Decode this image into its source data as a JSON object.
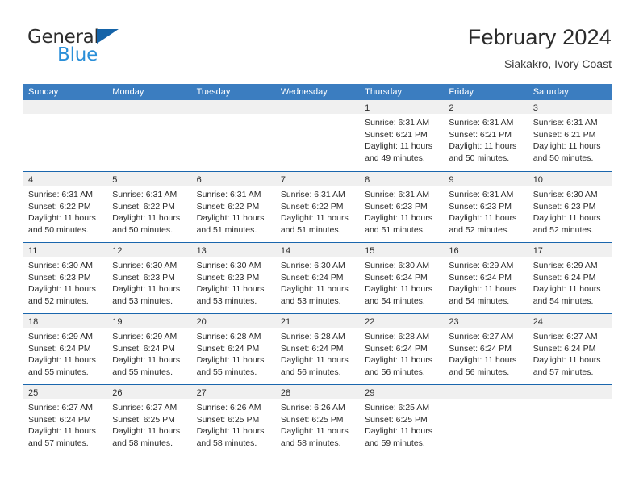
{
  "brand": {
    "name_part1": "General",
    "name_part2": "Blue",
    "accent_color": "#2a8fd8",
    "triangle_color": "#1463a8"
  },
  "header": {
    "title": "February 2024",
    "subtitle": "Siakakro, Ivory Coast"
  },
  "calendar": {
    "header_bg": "#3b7dc0",
    "row_border_color": "#1a66ad",
    "daynum_band_bg": "#f0f0f0",
    "weekdays": [
      "Sunday",
      "Monday",
      "Tuesday",
      "Wednesday",
      "Thursday",
      "Friday",
      "Saturday"
    ],
    "weeks": [
      [
        {
          "day": "",
          "sunrise": "",
          "sunset": "",
          "daylight": "",
          "empty": true
        },
        {
          "day": "",
          "sunrise": "",
          "sunset": "",
          "daylight": "",
          "empty": true
        },
        {
          "day": "",
          "sunrise": "",
          "sunset": "",
          "daylight": "",
          "empty": true
        },
        {
          "day": "",
          "sunrise": "",
          "sunset": "",
          "daylight": "",
          "empty": true
        },
        {
          "day": "1",
          "sunrise": "Sunrise: 6:31 AM",
          "sunset": "Sunset: 6:21 PM",
          "daylight": "Daylight: 11 hours and 49 minutes."
        },
        {
          "day": "2",
          "sunrise": "Sunrise: 6:31 AM",
          "sunset": "Sunset: 6:21 PM",
          "daylight": "Daylight: 11 hours and 50 minutes."
        },
        {
          "day": "3",
          "sunrise": "Sunrise: 6:31 AM",
          "sunset": "Sunset: 6:21 PM",
          "daylight": "Daylight: 11 hours and 50 minutes."
        }
      ],
      [
        {
          "day": "4",
          "sunrise": "Sunrise: 6:31 AM",
          "sunset": "Sunset: 6:22 PM",
          "daylight": "Daylight: 11 hours and 50 minutes."
        },
        {
          "day": "5",
          "sunrise": "Sunrise: 6:31 AM",
          "sunset": "Sunset: 6:22 PM",
          "daylight": "Daylight: 11 hours and 50 minutes."
        },
        {
          "day": "6",
          "sunrise": "Sunrise: 6:31 AM",
          "sunset": "Sunset: 6:22 PM",
          "daylight": "Daylight: 11 hours and 51 minutes."
        },
        {
          "day": "7",
          "sunrise": "Sunrise: 6:31 AM",
          "sunset": "Sunset: 6:22 PM",
          "daylight": "Daylight: 11 hours and 51 minutes."
        },
        {
          "day": "8",
          "sunrise": "Sunrise: 6:31 AM",
          "sunset": "Sunset: 6:23 PM",
          "daylight": "Daylight: 11 hours and 51 minutes."
        },
        {
          "day": "9",
          "sunrise": "Sunrise: 6:31 AM",
          "sunset": "Sunset: 6:23 PM",
          "daylight": "Daylight: 11 hours and 52 minutes."
        },
        {
          "day": "10",
          "sunrise": "Sunrise: 6:30 AM",
          "sunset": "Sunset: 6:23 PM",
          "daylight": "Daylight: 11 hours and 52 minutes."
        }
      ],
      [
        {
          "day": "11",
          "sunrise": "Sunrise: 6:30 AM",
          "sunset": "Sunset: 6:23 PM",
          "daylight": "Daylight: 11 hours and 52 minutes."
        },
        {
          "day": "12",
          "sunrise": "Sunrise: 6:30 AM",
          "sunset": "Sunset: 6:23 PM",
          "daylight": "Daylight: 11 hours and 53 minutes."
        },
        {
          "day": "13",
          "sunrise": "Sunrise: 6:30 AM",
          "sunset": "Sunset: 6:23 PM",
          "daylight": "Daylight: 11 hours and 53 minutes."
        },
        {
          "day": "14",
          "sunrise": "Sunrise: 6:30 AM",
          "sunset": "Sunset: 6:24 PM",
          "daylight": "Daylight: 11 hours and 53 minutes."
        },
        {
          "day": "15",
          "sunrise": "Sunrise: 6:30 AM",
          "sunset": "Sunset: 6:24 PM",
          "daylight": "Daylight: 11 hours and 54 minutes."
        },
        {
          "day": "16",
          "sunrise": "Sunrise: 6:29 AM",
          "sunset": "Sunset: 6:24 PM",
          "daylight": "Daylight: 11 hours and 54 minutes."
        },
        {
          "day": "17",
          "sunrise": "Sunrise: 6:29 AM",
          "sunset": "Sunset: 6:24 PM",
          "daylight": "Daylight: 11 hours and 54 minutes."
        }
      ],
      [
        {
          "day": "18",
          "sunrise": "Sunrise: 6:29 AM",
          "sunset": "Sunset: 6:24 PM",
          "daylight": "Daylight: 11 hours and 55 minutes."
        },
        {
          "day": "19",
          "sunrise": "Sunrise: 6:29 AM",
          "sunset": "Sunset: 6:24 PM",
          "daylight": "Daylight: 11 hours and 55 minutes."
        },
        {
          "day": "20",
          "sunrise": "Sunrise: 6:28 AM",
          "sunset": "Sunset: 6:24 PM",
          "daylight": "Daylight: 11 hours and 55 minutes."
        },
        {
          "day": "21",
          "sunrise": "Sunrise: 6:28 AM",
          "sunset": "Sunset: 6:24 PM",
          "daylight": "Daylight: 11 hours and 56 minutes."
        },
        {
          "day": "22",
          "sunrise": "Sunrise: 6:28 AM",
          "sunset": "Sunset: 6:24 PM",
          "daylight": "Daylight: 11 hours and 56 minutes."
        },
        {
          "day": "23",
          "sunrise": "Sunrise: 6:27 AM",
          "sunset": "Sunset: 6:24 PM",
          "daylight": "Daylight: 11 hours and 56 minutes."
        },
        {
          "day": "24",
          "sunrise": "Sunrise: 6:27 AM",
          "sunset": "Sunset: 6:24 PM",
          "daylight": "Daylight: 11 hours and 57 minutes."
        }
      ],
      [
        {
          "day": "25",
          "sunrise": "Sunrise: 6:27 AM",
          "sunset": "Sunset: 6:24 PM",
          "daylight": "Daylight: 11 hours and 57 minutes."
        },
        {
          "day": "26",
          "sunrise": "Sunrise: 6:27 AM",
          "sunset": "Sunset: 6:25 PM",
          "daylight": "Daylight: 11 hours and 58 minutes."
        },
        {
          "day": "27",
          "sunrise": "Sunrise: 6:26 AM",
          "sunset": "Sunset: 6:25 PM",
          "daylight": "Daylight: 11 hours and 58 minutes."
        },
        {
          "day": "28",
          "sunrise": "Sunrise: 6:26 AM",
          "sunset": "Sunset: 6:25 PM",
          "daylight": "Daylight: 11 hours and 58 minutes."
        },
        {
          "day": "29",
          "sunrise": "Sunrise: 6:25 AM",
          "sunset": "Sunset: 6:25 PM",
          "daylight": "Daylight: 11 hours and 59 minutes."
        },
        {
          "day": "",
          "sunrise": "",
          "sunset": "",
          "daylight": "",
          "empty": true
        },
        {
          "day": "",
          "sunrise": "",
          "sunset": "",
          "daylight": "",
          "empty": true
        }
      ]
    ]
  }
}
